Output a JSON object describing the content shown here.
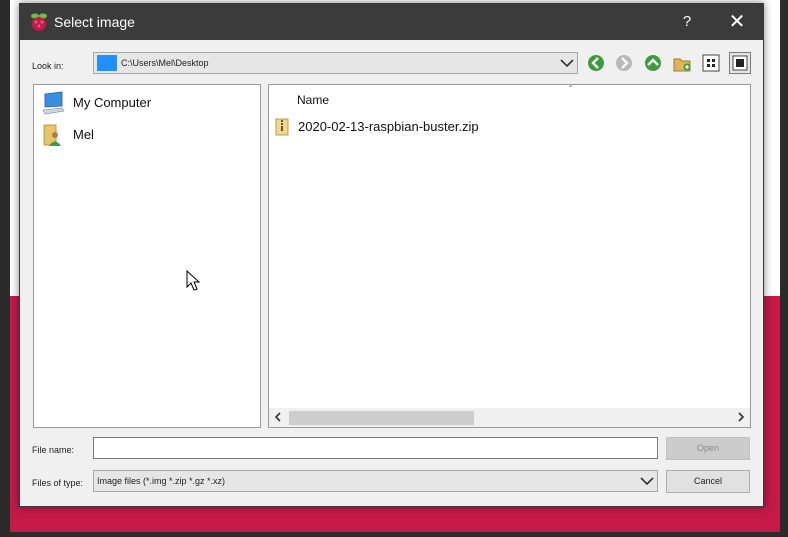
{
  "window": {
    "title": "Select image",
    "help_glyph": "?",
    "close_glyph": "✕"
  },
  "look_in": {
    "label": "Look in:",
    "path": "C:\\Users\\Mel\\Desktop",
    "icon": "folder-icon"
  },
  "toolbar": {
    "buttons": [
      {
        "name": "back-icon",
        "color": "#3d9b3d"
      },
      {
        "name": "forward-icon",
        "color": "#9a9a9a"
      },
      {
        "name": "parent-folder-icon",
        "color": "#3d9b3d"
      },
      {
        "name": "new-folder-icon",
        "color": "#c8a040"
      },
      {
        "name": "list-view-icon"
      },
      {
        "name": "detail-view-icon"
      }
    ]
  },
  "sidebar": {
    "items": [
      {
        "label": "My Computer",
        "icon": "computer-icon"
      },
      {
        "label": "Mel",
        "icon": "user-folder-icon"
      }
    ]
  },
  "file_list": {
    "columns": [
      "Name"
    ],
    "files": [
      {
        "name": "2020-02-13-raspbian-buster.zip",
        "icon": "zip-file-icon"
      }
    ]
  },
  "file_name": {
    "label": "File name:",
    "value": ""
  },
  "files_of_type": {
    "label": "Files of type:",
    "value": "Image files (*.img *.zip *.gz *.xz)"
  },
  "buttons": {
    "open": "Open",
    "cancel": "Cancel"
  },
  "colors": {
    "title_bar": "#3b3b3b",
    "accent_background": "#c51a4a",
    "dialog_background": "#f0f0f0"
  }
}
